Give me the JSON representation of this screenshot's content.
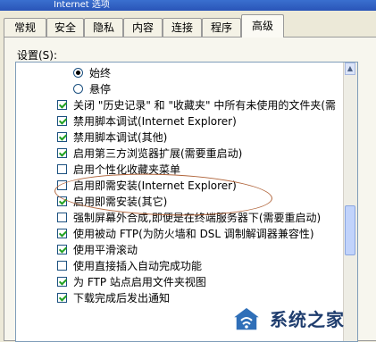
{
  "window": {
    "title": "Internet 选项"
  },
  "tabs": [
    {
      "label": "常规",
      "active": false
    },
    {
      "label": "安全",
      "active": false
    },
    {
      "label": "隐私",
      "active": false
    },
    {
      "label": "内容",
      "active": false
    },
    {
      "label": "连接",
      "active": false
    },
    {
      "label": "程序",
      "active": false
    },
    {
      "label": "高级",
      "active": true
    }
  ],
  "settings": {
    "label": "设置(S):",
    "items": [
      {
        "type": "radio",
        "checked": true,
        "label": "始终"
      },
      {
        "type": "radio",
        "checked": false,
        "label": "悬停"
      },
      {
        "type": "checkbox",
        "checked": true,
        "label": "关闭 \"历史记录\" 和 \"收藏夹\" 中所有未使用的文件夹(需"
      },
      {
        "type": "checkbox",
        "checked": true,
        "label": "禁用脚本调试(Internet Explorer)"
      },
      {
        "type": "checkbox",
        "checked": true,
        "label": "禁用脚本调试(其他)"
      },
      {
        "type": "checkbox",
        "checked": true,
        "label": "启用第三方浏览器扩展(需要重启动)"
      },
      {
        "type": "checkbox",
        "checked": false,
        "label": "启用个性化收藏夹菜单"
      },
      {
        "type": "checkbox",
        "checked": false,
        "label": "启用即需安装(Internet Explorer)"
      },
      {
        "type": "checkbox",
        "checked": true,
        "label": "启用即需安装(其它)"
      },
      {
        "type": "checkbox",
        "checked": false,
        "label": "强制屏幕外合成,即便是在终端服务器下(需要重启动)"
      },
      {
        "type": "checkbox",
        "checked": true,
        "label": "使用被动 FTP(为防火墙和 DSL 调制解调器兼容性)"
      },
      {
        "type": "checkbox",
        "checked": true,
        "label": "使用平滑滚动"
      },
      {
        "type": "checkbox",
        "checked": false,
        "label": "使用直接插入自动完成功能"
      },
      {
        "type": "checkbox",
        "checked": true,
        "label": "为 FTP 站点启用文件夹视图"
      },
      {
        "type": "checkbox",
        "checked": true,
        "label": "下载完成后发出通知"
      }
    ]
  },
  "watermark": {
    "text": "系统之家"
  }
}
